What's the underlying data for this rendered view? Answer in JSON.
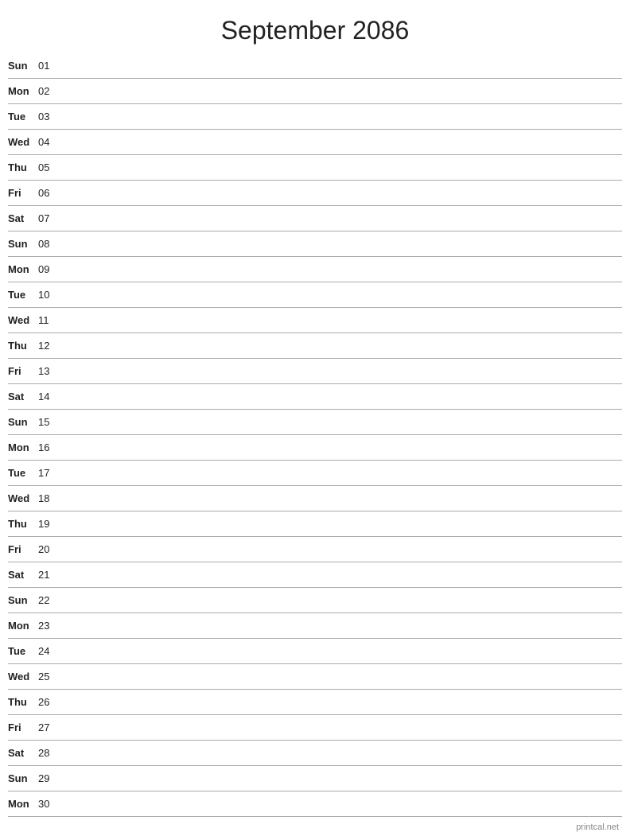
{
  "header": {
    "title": "September 2086"
  },
  "days": [
    {
      "name": "Sun",
      "number": "01"
    },
    {
      "name": "Mon",
      "number": "02"
    },
    {
      "name": "Tue",
      "number": "03"
    },
    {
      "name": "Wed",
      "number": "04"
    },
    {
      "name": "Thu",
      "number": "05"
    },
    {
      "name": "Fri",
      "number": "06"
    },
    {
      "name": "Sat",
      "number": "07"
    },
    {
      "name": "Sun",
      "number": "08"
    },
    {
      "name": "Mon",
      "number": "09"
    },
    {
      "name": "Tue",
      "number": "10"
    },
    {
      "name": "Wed",
      "number": "11"
    },
    {
      "name": "Thu",
      "number": "12"
    },
    {
      "name": "Fri",
      "number": "13"
    },
    {
      "name": "Sat",
      "number": "14"
    },
    {
      "name": "Sun",
      "number": "15"
    },
    {
      "name": "Mon",
      "number": "16"
    },
    {
      "name": "Tue",
      "number": "17"
    },
    {
      "name": "Wed",
      "number": "18"
    },
    {
      "name": "Thu",
      "number": "19"
    },
    {
      "name": "Fri",
      "number": "20"
    },
    {
      "name": "Sat",
      "number": "21"
    },
    {
      "name": "Sun",
      "number": "22"
    },
    {
      "name": "Mon",
      "number": "23"
    },
    {
      "name": "Tue",
      "number": "24"
    },
    {
      "name": "Wed",
      "number": "25"
    },
    {
      "name": "Thu",
      "number": "26"
    },
    {
      "name": "Fri",
      "number": "27"
    },
    {
      "name": "Sat",
      "number": "28"
    },
    {
      "name": "Sun",
      "number": "29"
    },
    {
      "name": "Mon",
      "number": "30"
    }
  ],
  "footer": {
    "text": "printcal.net"
  }
}
